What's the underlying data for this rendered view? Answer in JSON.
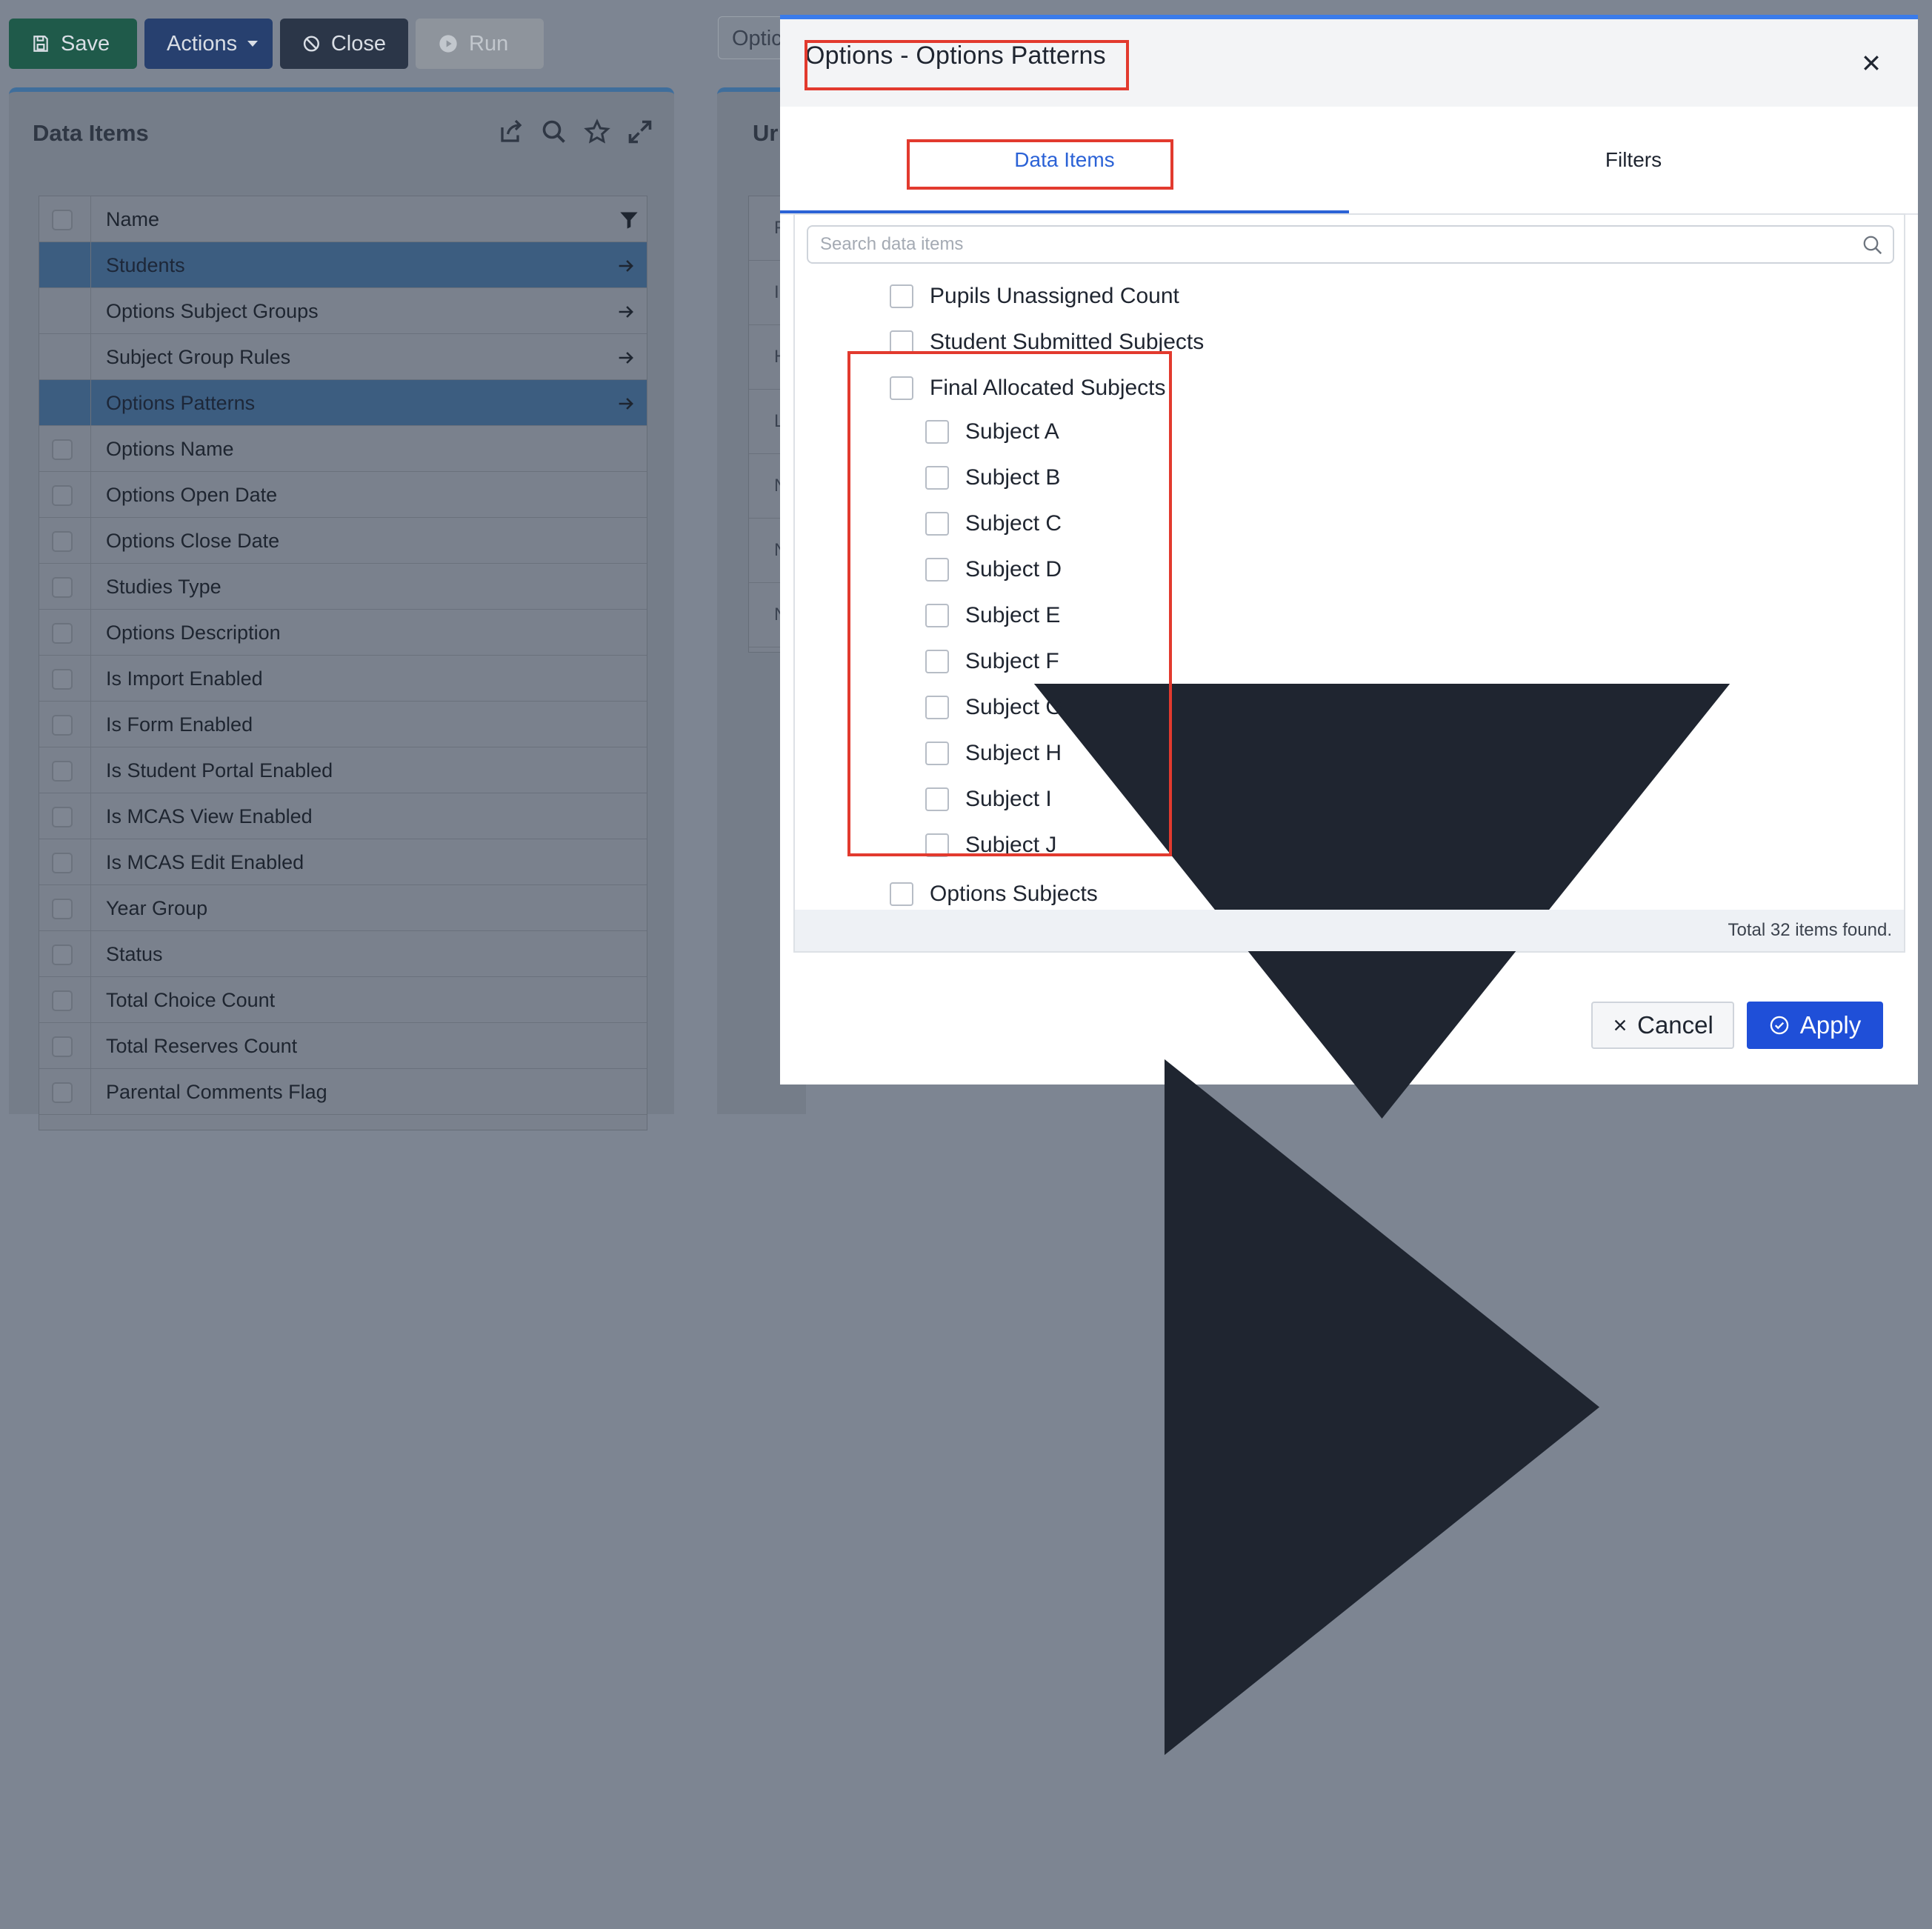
{
  "toolbar": {
    "save_label": "Save",
    "actions_label": "Actions",
    "close_label": "Close",
    "run_label": "Run",
    "search_fragment": "Optic"
  },
  "data_items_panel": {
    "title": "Data Items",
    "column_name": "Name",
    "rows": [
      {
        "label": "Students",
        "selected": true,
        "has_arrow": true,
        "has_checkbox": false
      },
      {
        "label": "Options Subject Groups",
        "selected": false,
        "has_arrow": true,
        "has_checkbox": false
      },
      {
        "label": "Subject Group Rules",
        "selected": false,
        "has_arrow": true,
        "has_checkbox": false
      },
      {
        "label": "Options Patterns",
        "selected": true,
        "has_arrow": true,
        "has_checkbox": false
      },
      {
        "label": "Options Name",
        "selected": false,
        "has_arrow": false,
        "has_checkbox": true
      },
      {
        "label": "Options Open Date",
        "selected": false,
        "has_arrow": false,
        "has_checkbox": true
      },
      {
        "label": "Options Close Date",
        "selected": false,
        "has_arrow": false,
        "has_checkbox": true
      },
      {
        "label": "Studies Type",
        "selected": false,
        "has_arrow": false,
        "has_checkbox": true
      },
      {
        "label": "Options Description",
        "selected": false,
        "has_arrow": false,
        "has_checkbox": true
      },
      {
        "label": "Is Import Enabled",
        "selected": false,
        "has_arrow": false,
        "has_checkbox": true
      },
      {
        "label": "Is Form Enabled",
        "selected": false,
        "has_arrow": false,
        "has_checkbox": true
      },
      {
        "label": "Is Student Portal Enabled",
        "selected": false,
        "has_arrow": false,
        "has_checkbox": true
      },
      {
        "label": "Is MCAS View Enabled",
        "selected": false,
        "has_arrow": false,
        "has_checkbox": true
      },
      {
        "label": "Is MCAS Edit Enabled",
        "selected": false,
        "has_arrow": false,
        "has_checkbox": true
      },
      {
        "label": "Year Group",
        "selected": false,
        "has_arrow": false,
        "has_checkbox": true
      },
      {
        "label": "Status",
        "selected": false,
        "has_arrow": false,
        "has_checkbox": true
      },
      {
        "label": "Total Choice Count",
        "selected": false,
        "has_arrow": false,
        "has_checkbox": true
      },
      {
        "label": "Total Reserves Count",
        "selected": false,
        "has_arrow": false,
        "has_checkbox": true
      },
      {
        "label": "Parental Comments Flag",
        "selected": false,
        "has_arrow": false,
        "has_checkbox": true
      }
    ]
  },
  "second_panel": {
    "title_fragment": "Ur",
    "row_fragments": [
      "F",
      "I",
      "H",
      "L",
      "N",
      "N",
      "N"
    ]
  },
  "modal": {
    "title": "Options - Options Patterns",
    "tabs": [
      "Data Items",
      "Filters"
    ],
    "active_tab": "Data Items",
    "search_placeholder": "Search data items",
    "tree": {
      "top_items": [
        "Pupils Unassigned Count",
        "Student Submitted Subjects"
      ],
      "expanded_group": {
        "label": "Final Allocated Subjects",
        "children": [
          "Subject A",
          "Subject B",
          "Subject C",
          "Subject D",
          "Subject E",
          "Subject F",
          "Subject G",
          "Subject H",
          "Subject I",
          "Subject J"
        ]
      },
      "collapsed_group": "Options Subjects"
    },
    "footer_text": "Total 32 items found.",
    "cancel_label": "Cancel",
    "apply_label": "Apply"
  },
  "colors": {
    "accent": "#2b62d6",
    "apply_button": "#1f4fd8",
    "highlight_box": "#e23a2e",
    "selected_row": "#3c5d80"
  }
}
